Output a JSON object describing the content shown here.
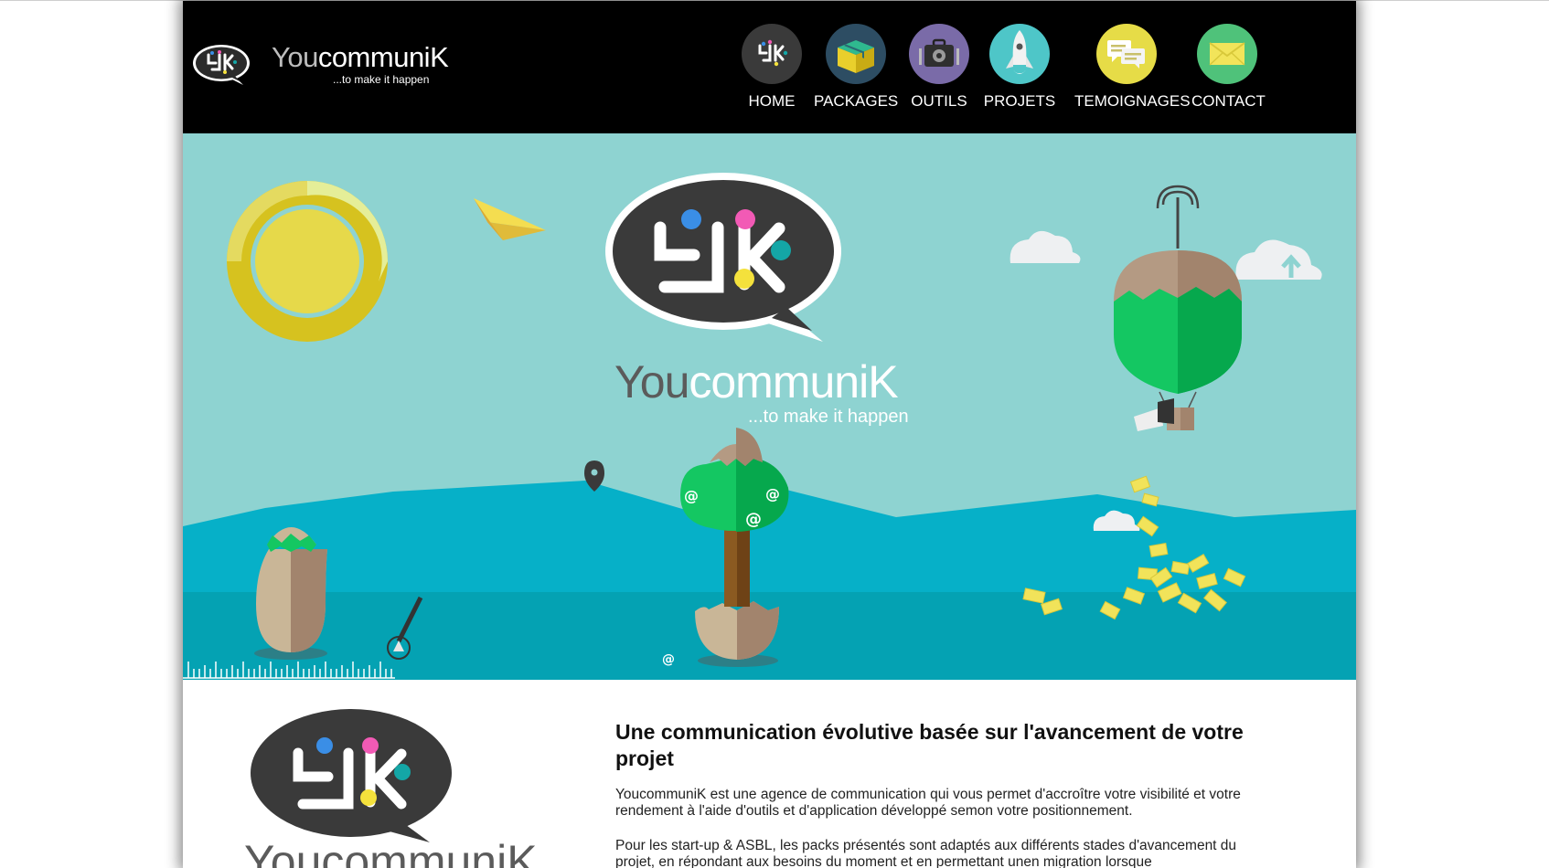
{
  "site": {
    "brand": {
      "name_light": "You",
      "name_bold": "communiK",
      "tagline": "...to make it happen"
    }
  },
  "nav": {
    "items": [
      {
        "label": "HOME",
        "icon": "ycomk-logo-icon",
        "color": "#3a3a3a"
      },
      {
        "label": "PACKAGES",
        "icon": "box-icon",
        "color": "#2d4d63"
      },
      {
        "label": "OUTILS",
        "icon": "toolbox-icon",
        "color": "#7a6ba8"
      },
      {
        "label": "PROJETS",
        "icon": "rocket-icon",
        "color": "#4ec6c8"
      },
      {
        "label": "TEMOIGNAGES",
        "icon": "chat-bubbles-icon",
        "color": "#e6dc47"
      },
      {
        "label": "CONTACT",
        "icon": "envelope-icon",
        "color": "#4fc27a"
      }
    ]
  },
  "hero": {
    "brand_light": "You",
    "brand_bold": "communiK",
    "tagline": "...to make it happen",
    "colors": {
      "sky": "#8ed3d1",
      "mountains": "#06b0c8",
      "ground": "#04a2b3",
      "balloon": "#0dbb55"
    }
  },
  "content": {
    "logo_brand_partial": "YoucommuniK",
    "title": "Une communication évolutive basée sur l'avancement de votre projet",
    "paragraphs": [
      "YoucommuniK est une agence de communication qui vous permet d'accroître votre visibilité et votre rendement à l'aide d'outils et d'application développé semon votre positionnement.",
      "Pour les start-up & ASBL, les packs présentés sont adaptés aux différents stades d'avancement du projet, en répondant aux besoins du moment et en permettant unen migration lorsque"
    ]
  }
}
